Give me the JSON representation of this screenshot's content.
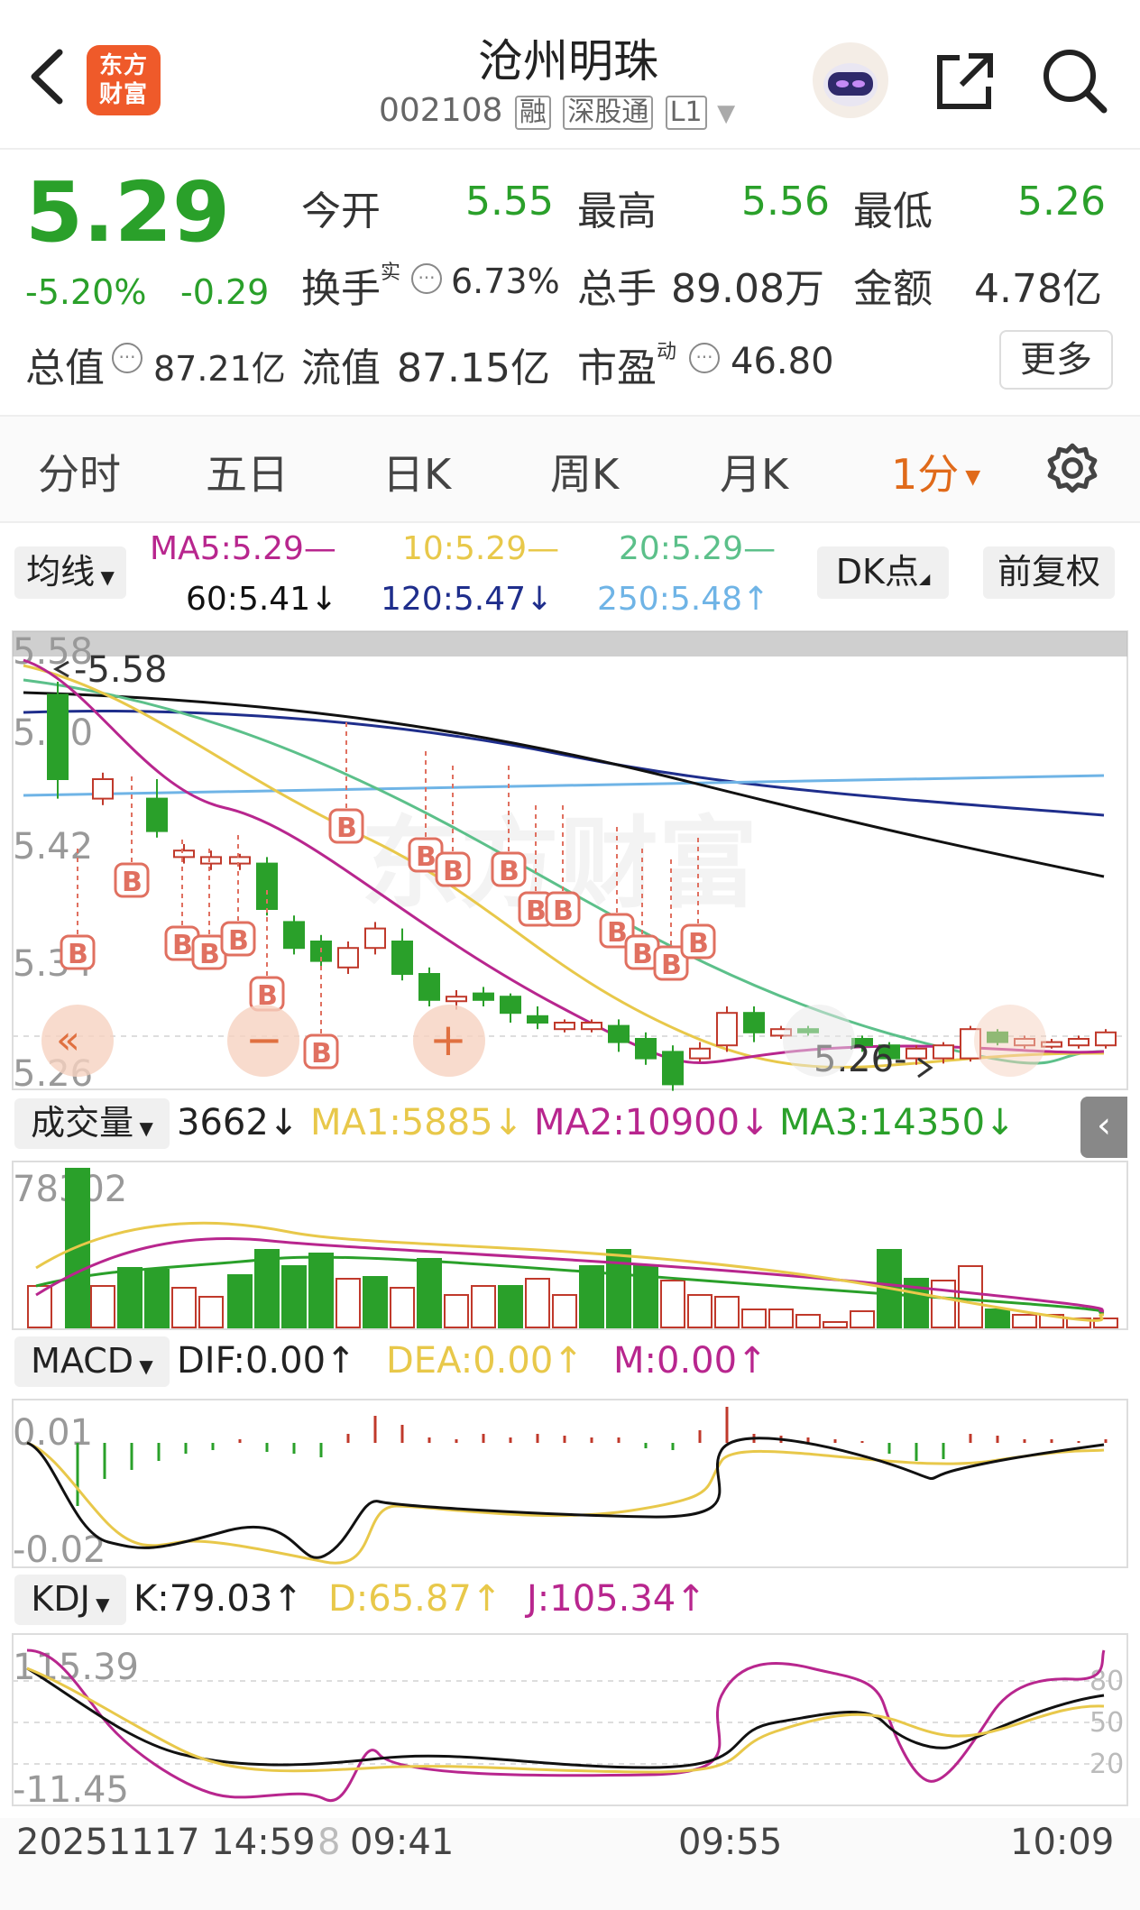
{
  "header": {
    "title": "沧州明珠",
    "code": "002108",
    "tag_rong": "融",
    "tag_sgt": "深股通",
    "tag_level": "L1",
    "logo_line1": "东方",
    "logo_line2": "财富"
  },
  "quote": {
    "price": "5.29",
    "change_pct": "-5.20%",
    "change_amt": "-0.29",
    "open_label": "今开",
    "open": "5.55",
    "high_label": "最高",
    "high": "5.56",
    "low_label": "最低",
    "low": "5.26",
    "turnover_label": "换手",
    "turnover_sup": "实",
    "turnover": "6.73%",
    "volume_label": "总手",
    "volume": "89.08万",
    "amount_label": "金额",
    "amount": "4.78亿",
    "mktcap_label": "总值",
    "mktcap": "87.21亿",
    "float_label": "流值",
    "float_cap": "87.15亿",
    "pe_label": "市盈",
    "pe_sup": "动",
    "pe": "46.80",
    "more_label": "更多"
  },
  "tabs": [
    "分时",
    "五日",
    "日K",
    "周K",
    "月K",
    "1分"
  ],
  "active_tab": "1分",
  "ma_bar": {
    "selector": "均线",
    "ma5": "MA5:5.29",
    "ma10": "10:5.29",
    "ma20": "20:5.29",
    "ma60": "60:5.41",
    "ma120": "120:5.47",
    "ma250": "250:5.48",
    "dk_label": "DK点",
    "adjust_label": "前复权",
    "colors": {
      "ma5": "#b8268e",
      "ma10": "#e8c84a",
      "ma20": "#5cc08a",
      "ma60": "#111111",
      "ma120": "#1f2e8c",
      "ma250": "#6fb4e6"
    }
  },
  "kline": {
    "y_labels": [
      "5.58",
      "5.50",
      "5.42",
      "5.34",
      "5.26"
    ],
    "high_marker": "5.58",
    "low_marker": "5.26",
    "watermark": "东方财富"
  },
  "volume_bar": {
    "selector": "成交量",
    "value": "3662",
    "ma1": "MA1:5885",
    "ma2": "MA2:10900",
    "ma3": "MA3:14350",
    "y_max": "78302"
  },
  "macd_bar": {
    "selector": "MACD",
    "dif": "DIF:0.00",
    "dea": "DEA:0.00",
    "m": "M:0.00",
    "y_top": "0.01",
    "y_bottom": "-0.02"
  },
  "kdj_bar": {
    "selector": "KDJ",
    "k": "K:79.03",
    "d": "D:65.87",
    "j": "J:105.34",
    "y_top": "115.39",
    "y_bottom": "-11.45",
    "levels": [
      "80",
      "50",
      "20"
    ]
  },
  "time_axis": [
    "20251117 14:59",
    "8",
    "09:41",
    "09:55",
    "10:09"
  ],
  "arrows": {
    "down": "↓",
    "up": "↑"
  },
  "b_label": "B",
  "nav_buttons": {
    "prev": "«",
    "zoom_out": "−",
    "zoom_in": "+"
  }
}
